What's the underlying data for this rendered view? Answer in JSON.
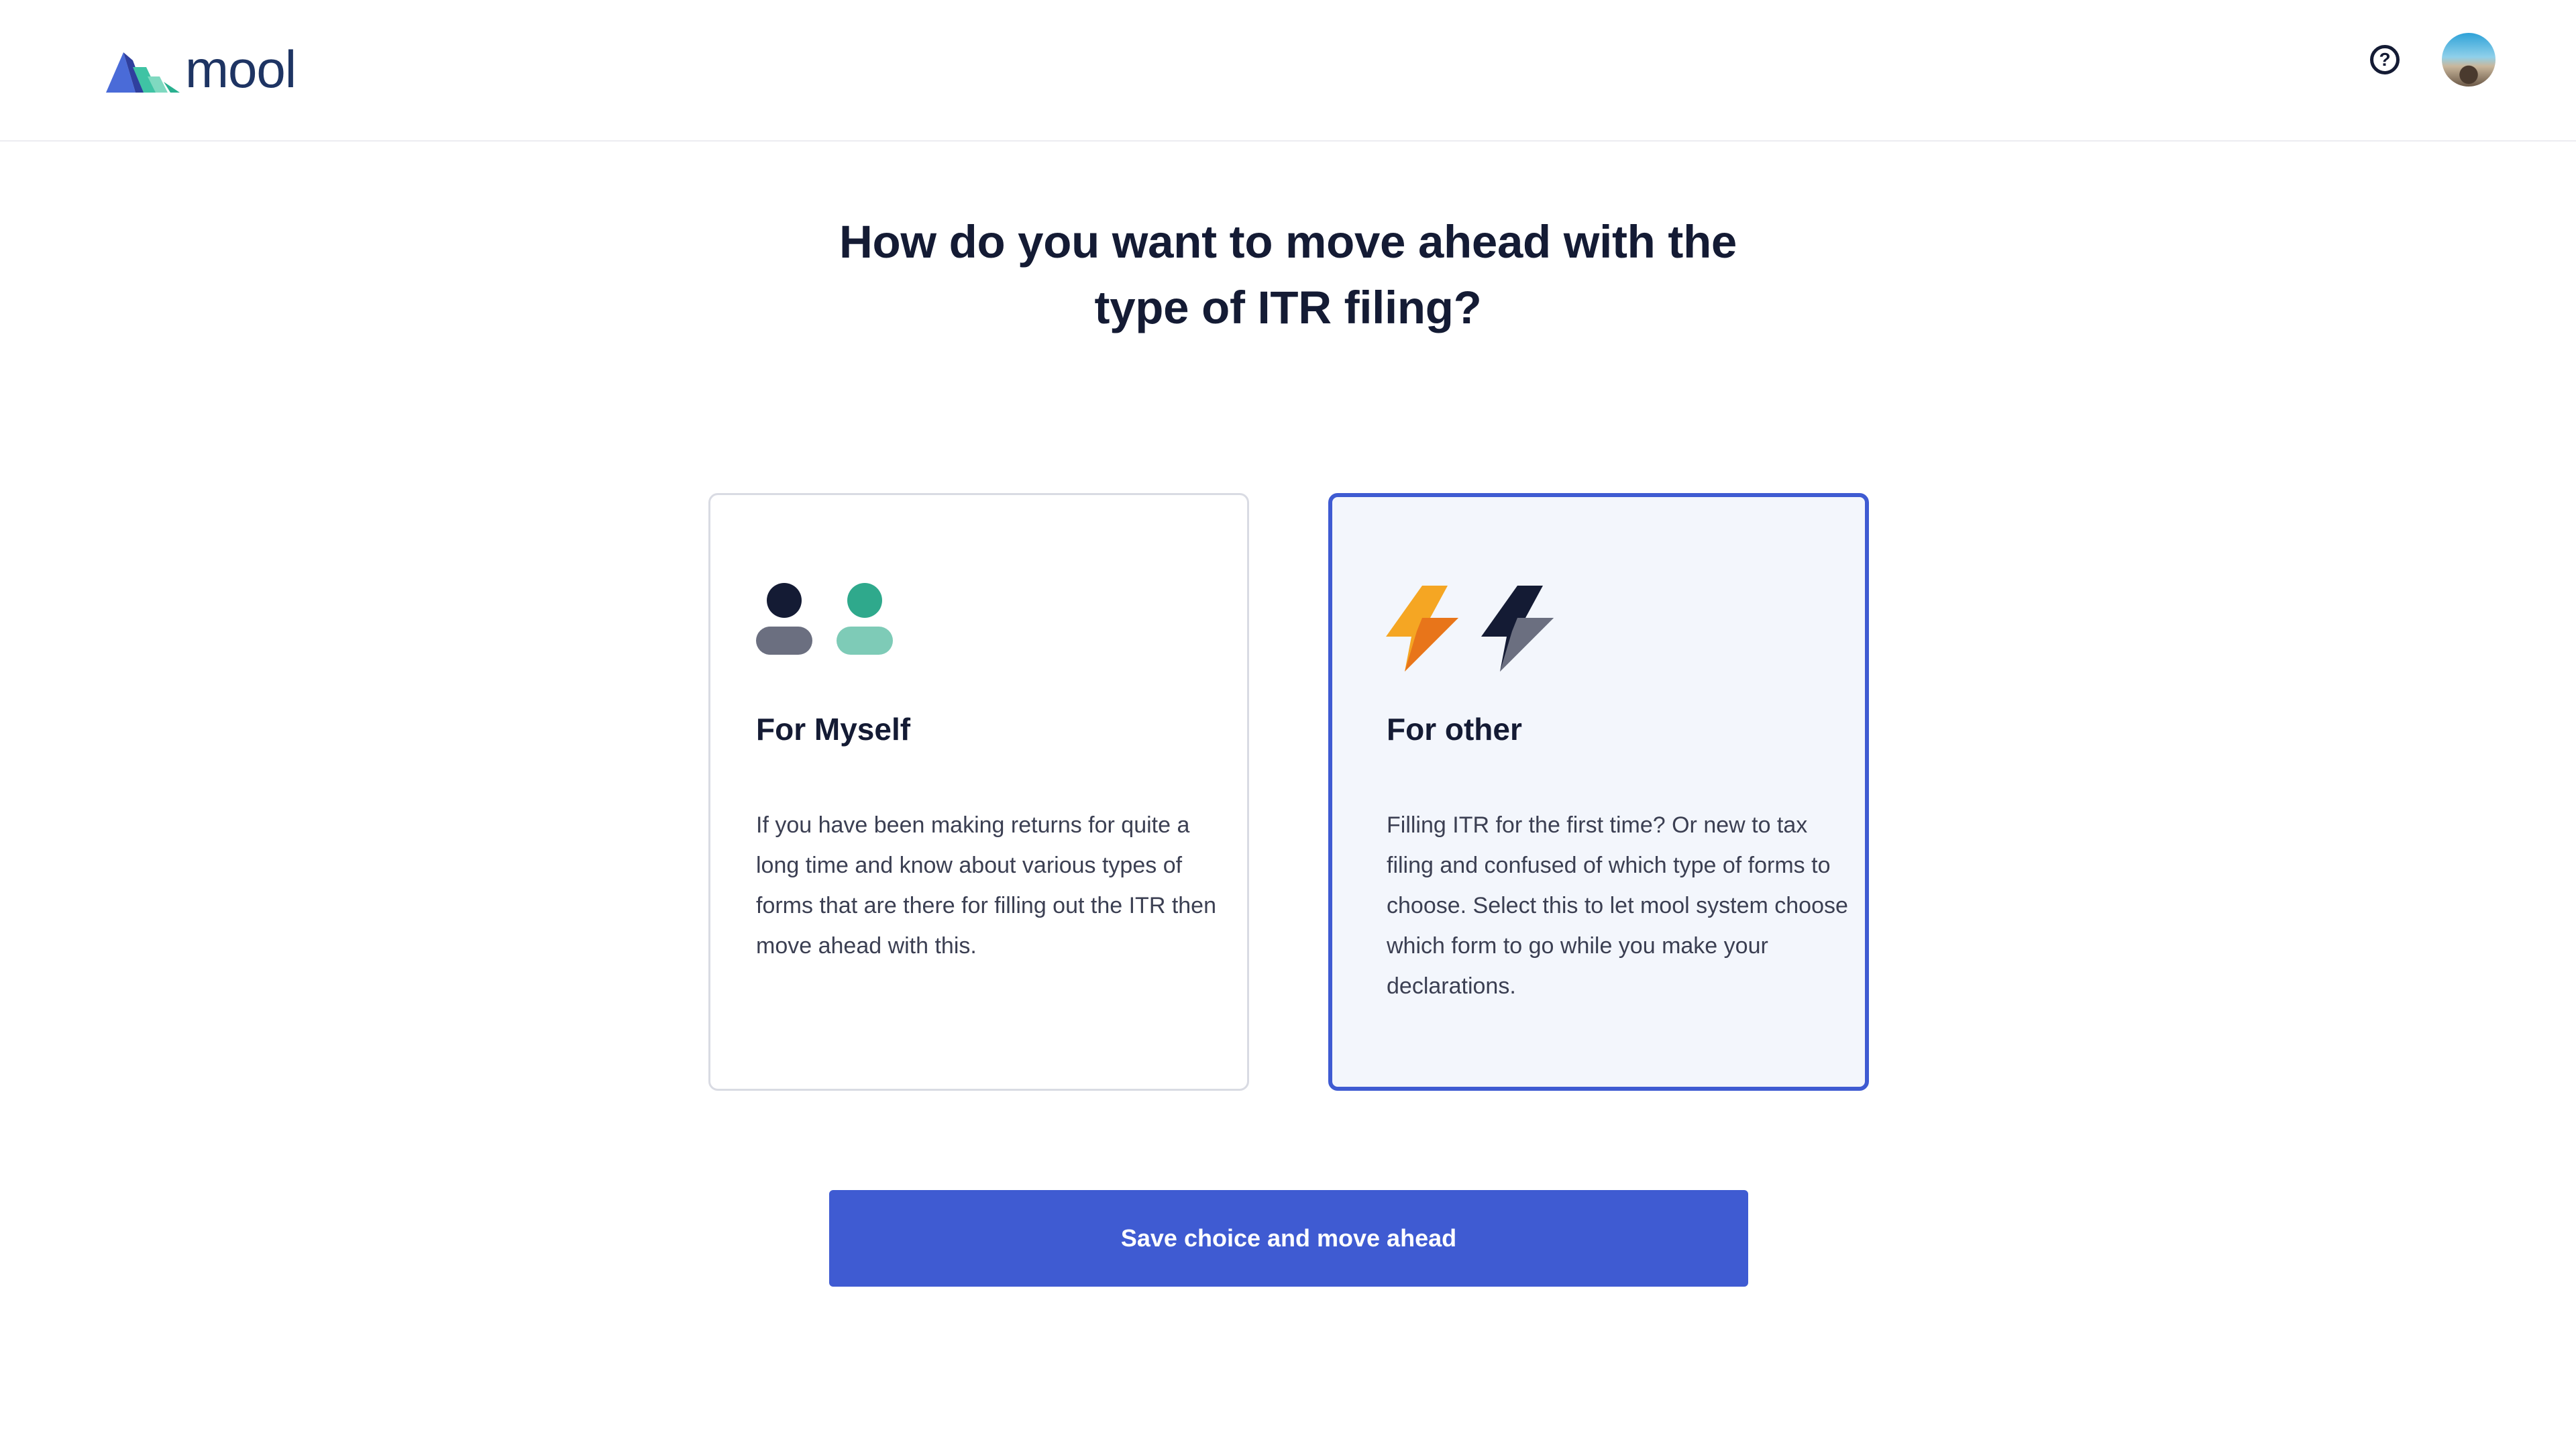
{
  "header": {
    "brand": "mool",
    "help_icon": "question-circle-icon",
    "avatar_icon": "user-avatar"
  },
  "main": {
    "title_line1": "How do you want to move ahead with the",
    "title_line2": "type of ITR filing?",
    "options": [
      {
        "title": "For Myself",
        "description": "If you have been making returns for quite a long time and know about various types of forms that are there for filling out the ITR then move ahead with this.",
        "icon": "two-people-icon",
        "selected": false
      },
      {
        "title": "For other",
        "description": "Filling ITR for the first time? Or new to tax filing and confused of which type of forms to choose. Select this to let mool system choose which form to go while you make your declarations.",
        "icon": "lightning-bolts-icon",
        "selected": true
      }
    ],
    "cta_label": "Save choice and move ahead"
  },
  "colors": {
    "accent": "#3f5bd2",
    "selected_card_bg": "#f3f6fc",
    "text_dark": "#141b34",
    "teal": "#2fa98c",
    "orange": "#f28c1b"
  }
}
